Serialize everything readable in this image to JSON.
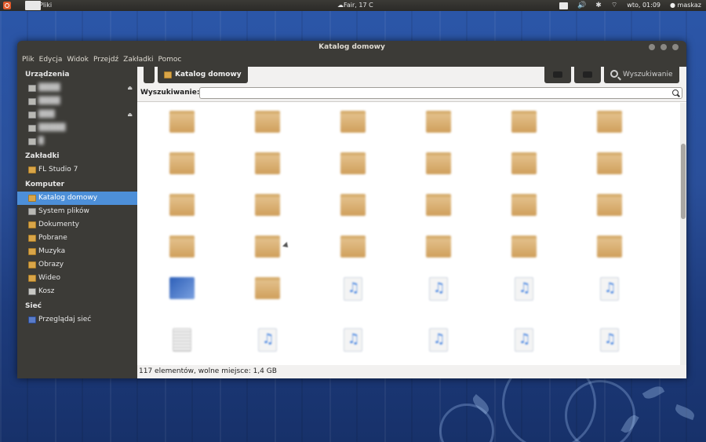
{
  "top_panel": {
    "app_name": "Pliki",
    "weather": "☁Fair, 17 C",
    "clock": "wto, 01:09",
    "user": "maskaz"
  },
  "window": {
    "title": "Katalog domowy"
  },
  "menu": [
    "Plik",
    "Edycja",
    "Widok",
    "Przejdź",
    "Zakładki",
    "Pomoc"
  ],
  "sidebar": {
    "devices_title": "Urządzenia",
    "devices": [
      "",
      "",
      "",
      "",
      ""
    ],
    "bookmarks_title": "Zakładki",
    "bookmarks": [
      "FL Studio 7"
    ],
    "computer_title": "Komputer",
    "computer": [
      {
        "label": "Katalog domowy",
        "icon": "home-folder-icon",
        "selected": true
      },
      {
        "label": "System plików",
        "icon": "drive-icon"
      },
      {
        "label": "Dokumenty",
        "icon": "folder-icon"
      },
      {
        "label": "Pobrane",
        "icon": "folder-icon"
      },
      {
        "label": "Muzyka",
        "icon": "folder-icon"
      },
      {
        "label": "Obrazy",
        "icon": "folder-icon"
      },
      {
        "label": "Wideo",
        "icon": "folder-icon"
      },
      {
        "label": "Kosz",
        "icon": "trash-icon"
      }
    ],
    "network_title": "Sieć",
    "network": [
      "Przeglądaj sieć"
    ]
  },
  "toolbar": {
    "path_label": "Katalog domowy",
    "search_label": "Wyszukiwanie"
  },
  "searchbar": {
    "label": "Wyszukiwanie:",
    "value": ""
  },
  "files": [
    {
      "type": "folder"
    },
    {
      "type": "folder"
    },
    {
      "type": "folder"
    },
    {
      "type": "folder"
    },
    {
      "type": "folder"
    },
    {
      "type": "folder"
    },
    {
      "type": "folder"
    },
    {
      "type": "folder"
    },
    {
      "type": "folder"
    },
    {
      "type": "folder"
    },
    {
      "type": "folder"
    },
    {
      "type": "folder"
    },
    {
      "type": "folder"
    },
    {
      "type": "folder"
    },
    {
      "type": "folder"
    },
    {
      "type": "folder"
    },
    {
      "type": "folder"
    },
    {
      "type": "folder"
    },
    {
      "type": "folder"
    },
    {
      "type": "folder"
    },
    {
      "type": "folder"
    },
    {
      "type": "folder"
    },
    {
      "type": "folder"
    },
    {
      "type": "folder"
    },
    {
      "type": "image"
    },
    {
      "type": "folder"
    },
    {
      "type": "audio"
    },
    {
      "type": "audio"
    },
    {
      "type": "audio"
    },
    {
      "type": "audio"
    },
    {
      "type": "doc"
    },
    {
      "type": "audio"
    },
    {
      "type": "audio"
    },
    {
      "type": "audio"
    },
    {
      "type": "audio"
    },
    {
      "type": "audio"
    }
  ],
  "status": "117 elementów, wolne miejsce: 1,4 GB"
}
